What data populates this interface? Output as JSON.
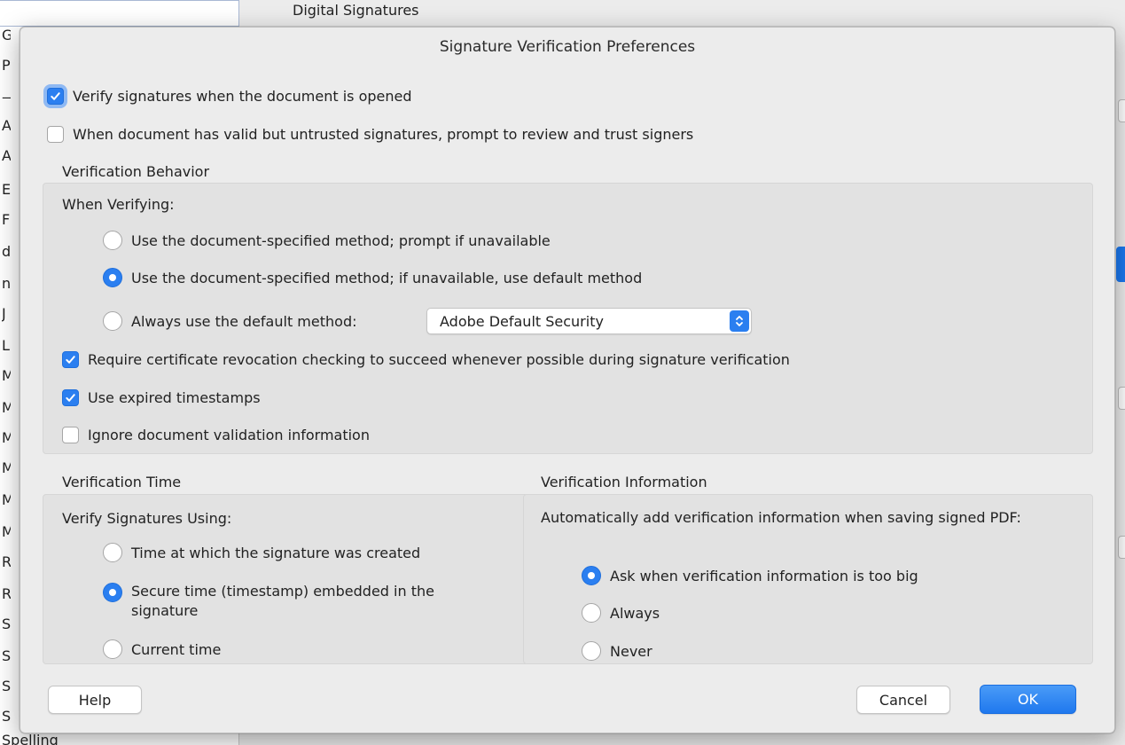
{
  "background": {
    "section_title": "Digital Signatures",
    "sidebar_letters": [
      "G",
      "P",
      "—",
      "A",
      "A",
      "E",
      "F",
      "d",
      "n",
      "J",
      "L",
      "M",
      "M",
      "M",
      "M",
      "M",
      "M",
      "R",
      "R",
      "S",
      "S",
      "S",
      "S"
    ],
    "sidebar_bottom_item": "Spelling"
  },
  "dialog": {
    "title": "Signature Verification Preferences",
    "verify_on_open": {
      "label": "Verify signatures when the document is opened",
      "checked": true
    },
    "prompt_untrusted": {
      "label": "When document has valid but untrusted signatures, prompt to review and trust signers",
      "checked": false
    },
    "verification_behavior": {
      "heading": "Verification Behavior",
      "when_verifying_label": "When Verifying:",
      "options": [
        {
          "label": "Use the document-specified method; prompt if unavailable",
          "selected": false
        },
        {
          "label": "Use the document-specified method; if unavailable, use default method",
          "selected": true
        },
        {
          "label": "Always use the default method:",
          "selected": false
        }
      ],
      "default_method_select": {
        "value": "Adobe Default Security",
        "icon": "up-down-chevron-icon"
      },
      "require_revocation": {
        "label": "Require certificate revocation checking to succeed whenever possible during signature verification",
        "checked": true
      },
      "use_expired_timestamps": {
        "label": "Use expired timestamps",
        "checked": true
      },
      "ignore_validation_info": {
        "label": "Ignore document validation information",
        "checked": false
      }
    },
    "verification_time": {
      "heading": "Verification Time",
      "using_label": "Verify Signatures Using:",
      "options": [
        {
          "label": "Time at which the signature was created",
          "selected": false
        },
        {
          "label": "Secure time (timestamp) embedded in the signature",
          "selected": true
        },
        {
          "label": "Current time",
          "selected": false
        }
      ]
    },
    "verification_information": {
      "heading": "Verification Information",
      "description": "Automatically add verification information when saving signed PDF:",
      "options": [
        {
          "label": "Ask when verification information is too big",
          "selected": true
        },
        {
          "label": "Always",
          "selected": false
        },
        {
          "label": "Never",
          "selected": false
        }
      ]
    },
    "buttons": {
      "help": "Help",
      "cancel": "Cancel",
      "ok": "OK"
    }
  },
  "colors": {
    "accent": "#2b7ff0",
    "dialog_bg": "#ececec",
    "group_bg": "#e2e2e2"
  }
}
